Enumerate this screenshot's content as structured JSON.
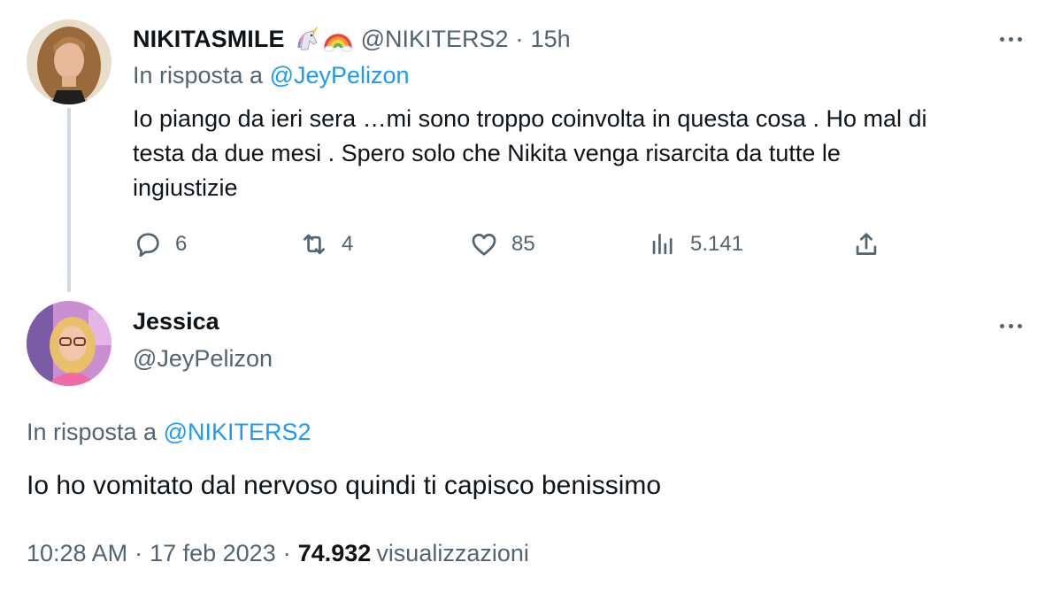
{
  "colors": {
    "text_primary": "#0f1419",
    "text_secondary": "#536471",
    "link": "#1d9bf0",
    "thread_line": "#cfd9de"
  },
  "tweet1": {
    "display_name": "NIKITASMILE",
    "emojis": [
      "unicorn-emoji",
      "rainbow-emoji"
    ],
    "handle": "@NIKITERS2",
    "separator": "·",
    "time": "15h",
    "reply_prefix": "In risposta a",
    "reply_handle": "@JeyPelizon",
    "text_lines": [
      "Io piango da ieri sera …mi sono troppo coinvolta in questa cosa . Ho mal di",
      "testa da due mesi . Spero solo che Nikita venga risarcita da tutte le",
      "ingiustizie"
    ],
    "actions": {
      "reply": {
        "icon": "reply-icon",
        "count": "6"
      },
      "retweet": {
        "icon": "retweet-icon",
        "count": "4"
      },
      "like": {
        "icon": "heart-icon",
        "count": "85"
      },
      "views": {
        "icon": "views-chart-icon",
        "count": "5.141"
      },
      "share": {
        "icon": "share-icon"
      }
    }
  },
  "tweet2": {
    "display_name": "Jessica",
    "handle": "@JeyPelizon",
    "reply_prefix": "In risposta a",
    "reply_handle": "@NIKITERS2",
    "text": "Io ho vomitato dal nervoso quindi ti capisco benissimo",
    "time": "10:28 AM",
    "separator": "·",
    "date": "17 feb 2023",
    "views_count": "74.932",
    "views_label": "visualizzazioni"
  }
}
